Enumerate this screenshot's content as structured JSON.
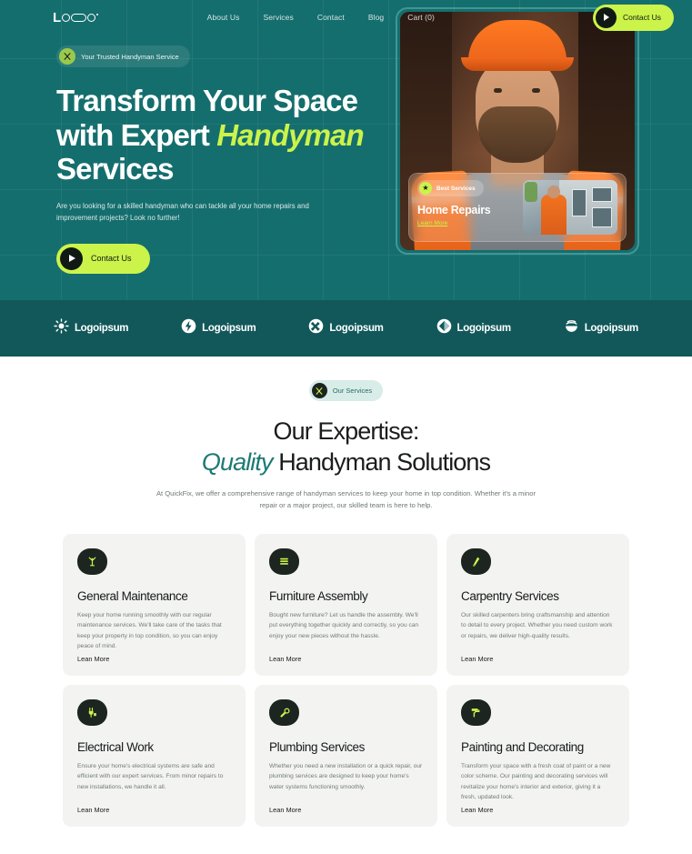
{
  "header": {
    "logo_text": "LOGO",
    "nav": [
      {
        "label": "About Us"
      },
      {
        "label": "Services"
      },
      {
        "label": "Contact"
      },
      {
        "label": "Blog"
      },
      {
        "label": "Cart (0)"
      }
    ],
    "cta_label": "Contact Us"
  },
  "hero": {
    "badge": "Your Trusted Handyman Service",
    "title_line1": "Transform Your Space",
    "title_line2_a": "with Expert ",
    "title_line2_em": "Handyman",
    "title_line3": "Services",
    "subtitle": "Are you looking for a skilled handyman who can tackle all your home repairs and improvement projects? Look no further!",
    "cta_label": "Contact Us",
    "overlay": {
      "badge": "Best Services",
      "title": "Home Repairs",
      "link": "Learn More"
    }
  },
  "logo_strip": {
    "brands": [
      {
        "name": "Logoipsum",
        "icon": "sun-icon"
      },
      {
        "name": "Logoipsum",
        "icon": "bolt-icon"
      },
      {
        "name": "Logoipsum",
        "icon": "cross-circle-icon"
      },
      {
        "name": "Logoipsum",
        "icon": "diamond-icon"
      },
      {
        "name": "Logoipsum",
        "icon": "wave-bowl-icon"
      }
    ]
  },
  "services": {
    "pill": "Our Services",
    "title_line1": "Our Expertise:",
    "title_line2_em": "Quality",
    "title_line2_rest": " Handyman Solutions",
    "subtitle": "At QuickFix, we offer a comprehensive range of handyman services to keep your home in top condition. Whether it's a minor repair or a major project, our skilled team is here to help.",
    "cards": [
      {
        "icon": "tools-icon",
        "title": "General Maintenance",
        "desc": "Keep your home running smoothly with our regular maintenance services. We'll take care of the tasks that keep your property in top condition, so you can enjoy peace of mind.",
        "link": "Lean More"
      },
      {
        "icon": "furniture-icon",
        "title": "Furniture Assembly",
        "desc": "Bought new furniture? Let us handle the assembly. We'll put everything together quickly and correctly, so you can enjoy your new pieces without the hassle.",
        "link": "Lean More"
      },
      {
        "icon": "saw-icon",
        "title": "Carpentry Services",
        "desc": "Our skilled carpenters bring craftsmanship and attention to detail to every project. Whether you need custom work or repairs, we deliver high-quality results.",
        "link": "Lean More"
      },
      {
        "icon": "plug-icon",
        "title": "Electrical Work",
        "desc": "Ensure your home's electrical systems are safe and efficient with our expert services. From minor repairs to new installations, we handle it all.",
        "link": "Lean More"
      },
      {
        "icon": "wrench-icon",
        "title": "Plumbing Services",
        "desc": "Whether you need a new installation or a quick repair, our plumbing services are designed to keep your home's water systems functioning smoothly.",
        "link": "Lean More"
      },
      {
        "icon": "paint-roller-icon",
        "title": "Painting and Decorating",
        "desc": "Transform your space with a fresh coat of paint or a new color scheme. Our painting and decorating services will revitalize your home's interior and exterior, giving it a fresh, updated look.",
        "link": "Lean More"
      }
    ]
  },
  "colors": {
    "teal": "#156E6E",
    "teal_dark": "#12585A",
    "lime": "#CBF34A",
    "ink": "#1C2520",
    "accent_teal": "#1D7A73"
  }
}
